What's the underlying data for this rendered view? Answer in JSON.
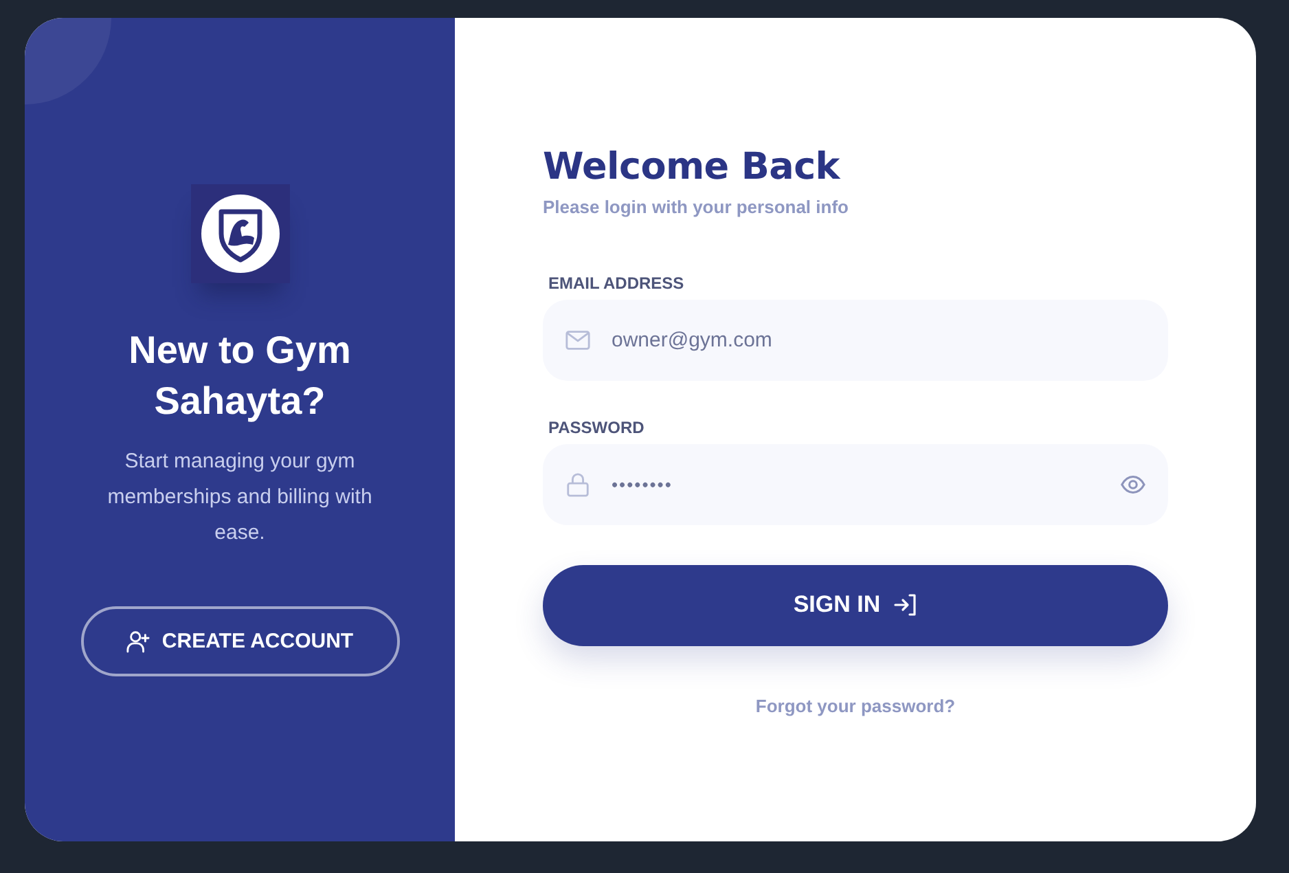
{
  "left_panel": {
    "heading": "New to Gym Sahayta?",
    "description": "Start managing your gym memberships and billing with ease.",
    "create_account_button": "CREATE ACCOUNT"
  },
  "login_form": {
    "title": "Welcome Back",
    "subtitle": "Please login with your personal info",
    "fields": [
      {
        "kind": "email",
        "label": "EMAIL ADDRESS",
        "value": "owner@gym.com"
      },
      {
        "kind": "password",
        "label": "PASSWORD",
        "value": "••••••••"
      }
    ],
    "sign_in_button": "SIGN IN",
    "forgot_password_link": "Forgot your password?"
  }
}
